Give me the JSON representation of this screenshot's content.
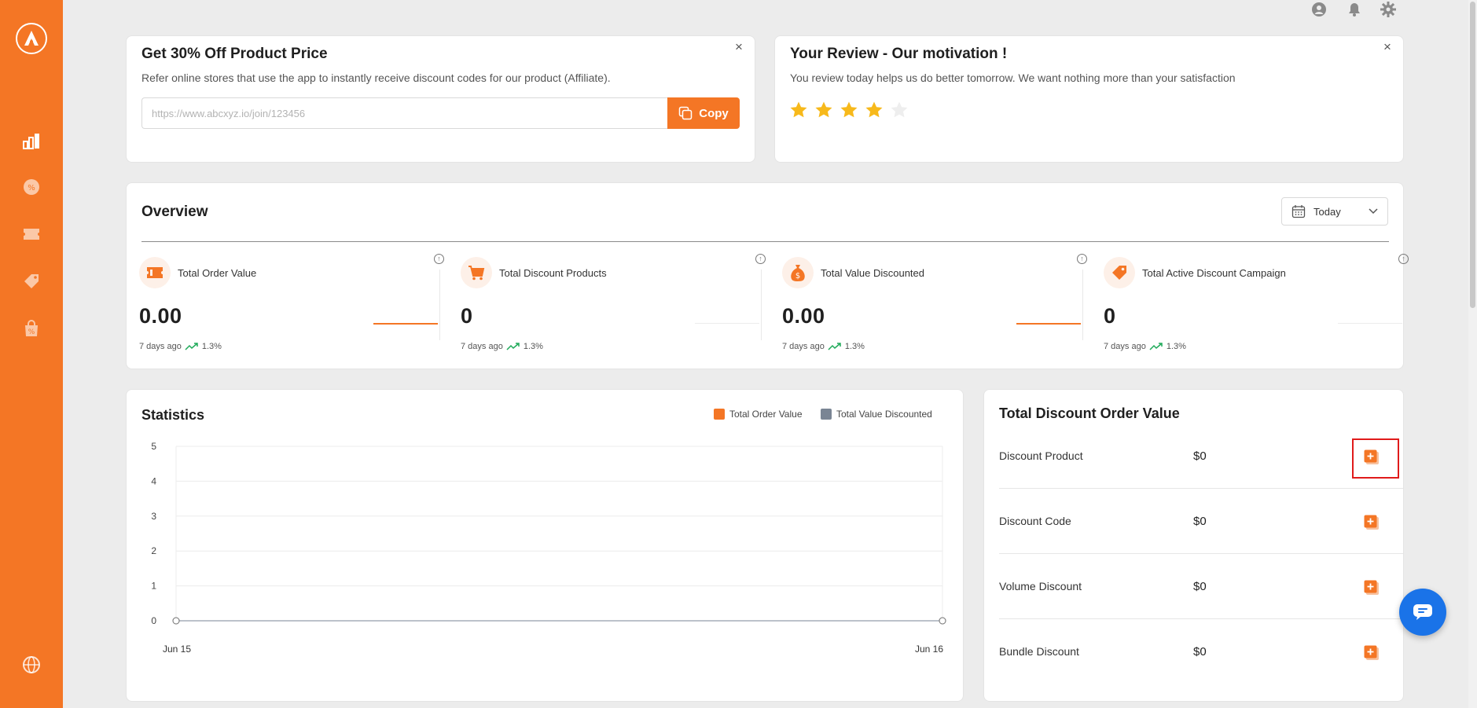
{
  "brand": {
    "accent": "#f47625",
    "chat_blue": "#1a73e8",
    "star_color": "#f7b91b"
  },
  "sidebar": {
    "logo": "app-logo-icon",
    "items": [
      {
        "icon": "analytics-icon"
      },
      {
        "icon": "discount-badge-icon"
      },
      {
        "icon": "ticket-icon"
      },
      {
        "icon": "price-tag-icon"
      },
      {
        "icon": "discount-bag-icon"
      },
      {
        "icon": "globe-icon"
      }
    ]
  },
  "topbar": {
    "icons": [
      "user-account-icon",
      "notification-bell-icon",
      "settings-gear-icon"
    ]
  },
  "affiliate": {
    "title": "Get 30% Off Product Price",
    "subtitle": "Refer online stores that use the app to instantly receive discount codes for our product (Affiliate).",
    "placeholder": "https://www.abcxyz.io/join/123456",
    "copy_label": "Copy"
  },
  "review": {
    "title": "Your Review - Our motivation !",
    "subtitle": "You review today helps us do better tomorrow. We want nothing more than your satisfaction",
    "rating": 4,
    "max_rating": 5
  },
  "overview": {
    "title": "Overview",
    "range": "Today",
    "metrics": [
      {
        "label": "Total Order Value",
        "value": "0.00",
        "ago": "7 days ago",
        "change": "1.3%",
        "icon": "ticket-icon"
      },
      {
        "label": "Total Discount Products",
        "value": "0",
        "ago": "7 days ago",
        "change": "1.3%",
        "icon": "cart-icon"
      },
      {
        "label": "Total Value Discounted",
        "value": "0.00",
        "ago": "7 days ago",
        "change": "1.3%",
        "icon": "money-bag-icon"
      },
      {
        "label": "Total Active Discount Campaign",
        "value": "0",
        "ago": "7 days ago",
        "change": "1.3%",
        "icon": "tag-icon"
      }
    ]
  },
  "statistics": {
    "title": "Statistics",
    "legend": [
      {
        "name": "Total Order Value",
        "color": "#f47625"
      },
      {
        "name": "Total Value Discounted",
        "color": "#7a8594"
      }
    ]
  },
  "chart_data": {
    "type": "line",
    "x": [
      "Jun 15",
      "Jun 16"
    ],
    "series": [
      {
        "name": "Total Order Value",
        "values": [
          0,
          0
        ]
      },
      {
        "name": "Total Value Discounted",
        "values": [
          0,
          0
        ]
      }
    ],
    "yticks": [
      0,
      1,
      2,
      3,
      4,
      5
    ],
    "ylim": [
      0,
      5
    ],
    "grid": true,
    "legend": "top-right"
  },
  "total_discount": {
    "title": "Total Discount Order Value",
    "rows": [
      {
        "label": "Discount Product",
        "value": "$0"
      },
      {
        "label": "Discount Code",
        "value": "$0"
      },
      {
        "label": "Volume Discount",
        "value": "$0"
      },
      {
        "label": "Bundle Discount",
        "value": "$0"
      }
    ]
  },
  "chat": {
    "icon": "chat-bubble-icon"
  }
}
